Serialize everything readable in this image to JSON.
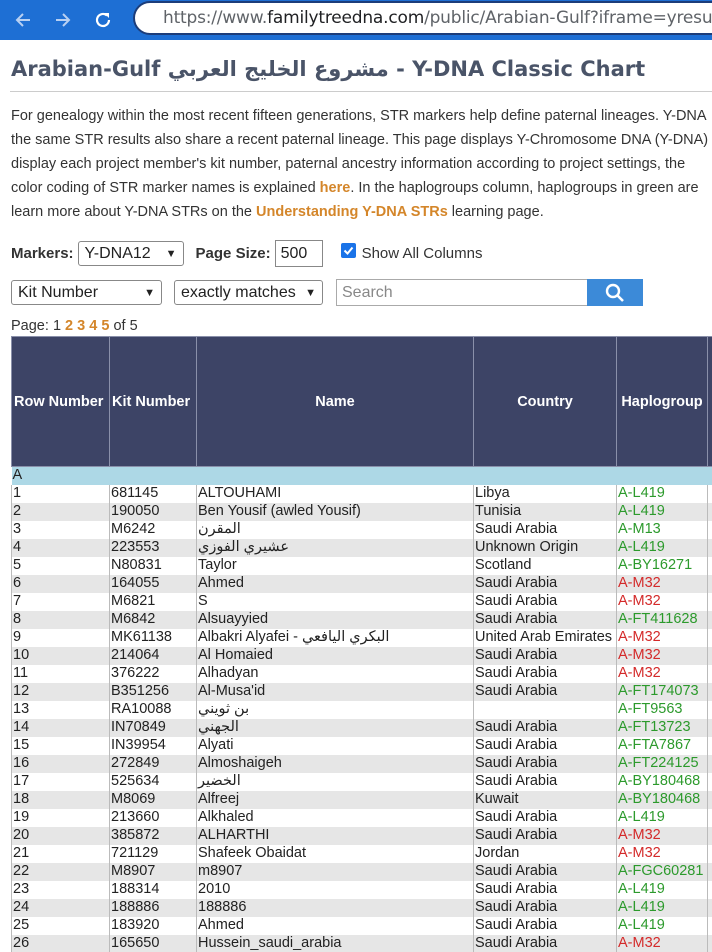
{
  "browser": {
    "url_prefix": "https://www.",
    "url_domain": "familytreedna.com",
    "url_path": "/public/Arabian-Gulf?iframe=yresults"
  },
  "page": {
    "title": "Arabian-Gulf مشروع الخليج العربي - Y-DNA Classic Chart"
  },
  "intro": {
    "line1": "For genealogy within the most recent fifteen generations, STR markers help define paternal lineages. Y-DNA",
    "line2": "the same STR results also share a recent paternal lineage. This page displays Y-Chromosome DNA (Y-DNA)",
    "line3": "display each project member's kit number, paternal ancestry information according to project settings, the",
    "line4_pre": "color coding of STR marker names is explained ",
    "line4_link": "here",
    "line4_post": ". In the haplogroups column, haplogroups in green are",
    "line5_pre": "learn more about Y-DNA STRs on the ",
    "line5_link": "Understanding Y-DNA STRs",
    "line5_post": " learning page."
  },
  "controls": {
    "markers_label": "Markers:",
    "markers_value": "Y-DNA12",
    "page_size_label": "Page Size:",
    "page_size_value": "500",
    "show_all_label": "Show All Columns",
    "field_select": "Kit Number",
    "match_select": "exactly matches",
    "search_placeholder": "Search"
  },
  "pager": {
    "label": "Page:",
    "current": "1",
    "pages": [
      "2",
      "3",
      "4",
      "5"
    ],
    "of_text": "of 5"
  },
  "table": {
    "headers": [
      "Row Number",
      "Kit Number",
      "Name",
      "Country",
      "Haplogroup"
    ],
    "group_label": "A",
    "rows": [
      {
        "n": "1",
        "kit": "681145",
        "name": "ALTOUHAMI",
        "country": "Libya",
        "hg": "A-L419",
        "hg_status": "green"
      },
      {
        "n": "2",
        "kit": "190050",
        "name": "Ben Yousif (awled Yousif)",
        "country": "Tunisia",
        "hg": "A-L419",
        "hg_status": "green"
      },
      {
        "n": "3",
        "kit": "M6242",
        "name": "المقرن",
        "country": "Saudi Arabia",
        "hg": "A-M13",
        "hg_status": "green"
      },
      {
        "n": "4",
        "kit": "223553",
        "name": "عشيري الفوزي",
        "country": "Unknown Origin",
        "hg": "A-L419",
        "hg_status": "green"
      },
      {
        "n": "5",
        "kit": "N80831",
        "name": "Taylor",
        "country": "Scotland",
        "hg": "A-BY16271",
        "hg_status": "green"
      },
      {
        "n": "6",
        "kit": "164055",
        "name": "Ahmed",
        "country": "Saudi Arabia",
        "hg": "A-M32",
        "hg_status": "red"
      },
      {
        "n": "7",
        "kit": "M6821",
        "name": "S",
        "country": "Saudi Arabia",
        "hg": "A-M32",
        "hg_status": "red"
      },
      {
        "n": "8",
        "kit": "M6842",
        "name": "Alsuayyied",
        "country": "Saudi Arabia",
        "hg": "A-FT411628",
        "hg_status": "green"
      },
      {
        "n": "9",
        "kit": "MK61138",
        "name": "Albakri Alyafei - البكري اليافعي",
        "country": "United Arab Emirates",
        "hg": "A-M32",
        "hg_status": "red"
      },
      {
        "n": "10",
        "kit": "214064",
        "name": "Al Homaied",
        "country": "Saudi Arabia",
        "hg": "A-M32",
        "hg_status": "red"
      },
      {
        "n": "11",
        "kit": "376222",
        "name": "Alhadyan",
        "country": "Saudi Arabia",
        "hg": "A-M32",
        "hg_status": "red"
      },
      {
        "n": "12",
        "kit": "B351256",
        "name": "Al-Musa'id",
        "country": "Saudi Arabia",
        "hg": "A-FT174073",
        "hg_status": "green"
      },
      {
        "n": "13",
        "kit": "RA10088",
        "name": "بن ثويني",
        "country": "",
        "hg": "A-FT9563",
        "hg_status": "green"
      },
      {
        "n": "14",
        "kit": "IN70849",
        "name": "الجهني",
        "country": "Saudi Arabia",
        "hg": "A-FT13723",
        "hg_status": "green"
      },
      {
        "n": "15",
        "kit": "IN39954",
        "name": "Alyati",
        "country": "Saudi Arabia",
        "hg": "A-FTA7867",
        "hg_status": "green"
      },
      {
        "n": "16",
        "kit": "272849",
        "name": "Almoshaigeh",
        "country": "Saudi Arabia",
        "hg": "A-FT224125",
        "hg_status": "green"
      },
      {
        "n": "17",
        "kit": "525634",
        "name": "الخضير",
        "country": "Saudi Arabia",
        "hg": "A-BY180468",
        "hg_status": "green"
      },
      {
        "n": "18",
        "kit": "M8069",
        "name": "Alfreej",
        "country": "Kuwait",
        "hg": "A-BY180468",
        "hg_status": "green"
      },
      {
        "n": "19",
        "kit": "213660",
        "name": "Alkhaled",
        "country": "Saudi Arabia",
        "hg": "A-L419",
        "hg_status": "green"
      },
      {
        "n": "20",
        "kit": "385872",
        "name": "ALHARTHI",
        "country": "Saudi Arabia",
        "hg": "A-M32",
        "hg_status": "red"
      },
      {
        "n": "21",
        "kit": "721129",
        "name": "Shafeek Obaidat",
        "country": "Jordan",
        "hg": "A-M32",
        "hg_status": "red"
      },
      {
        "n": "22",
        "kit": "M8907",
        "name": "m8907",
        "country": "Saudi Arabia",
        "hg": "A-FGC60281",
        "hg_status": "green"
      },
      {
        "n": "23",
        "kit": "188314",
        "name": "2010",
        "country": "Saudi Arabia",
        "hg": "A-L419",
        "hg_status": "green"
      },
      {
        "n": "24",
        "kit": "188886",
        "name": "188886",
        "country": "Saudi Arabia",
        "hg": "A-L419",
        "hg_status": "green"
      },
      {
        "n": "25",
        "kit": "183920",
        "name": "Ahmed",
        "country": "Saudi Arabia",
        "hg": "A-L419",
        "hg_status": "green"
      },
      {
        "n": "26",
        "kit": "165650",
        "name": "Hussein_saudi_arabia",
        "country": "Saudi Arabia",
        "hg": "A-M32",
        "hg_status": "red"
      }
    ]
  },
  "colors": {
    "chrome": "#1e6fd4",
    "header_bg": "#3d4466",
    "group_bg": "#add8e6",
    "link_orange": "#d4862a",
    "hg_green": "#2c9a2c",
    "hg_red": "#d42a2a"
  }
}
